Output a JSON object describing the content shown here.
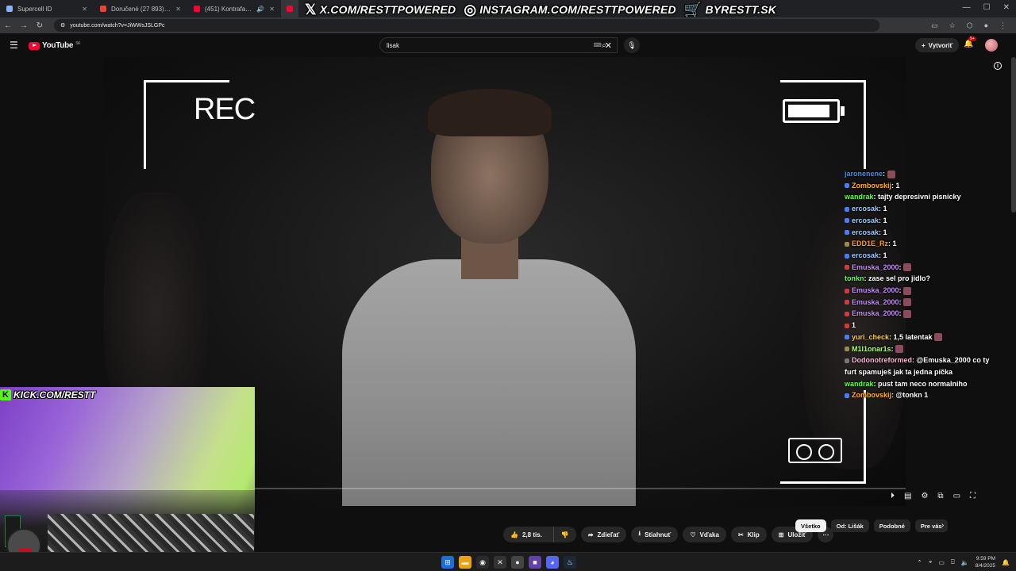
{
  "browser": {
    "tabs": [
      {
        "title": "Supercell ID",
        "icon": "supercell-icon"
      },
      {
        "title": "Doručené (27 893) - resttpowe",
        "icon": "gmail-icon"
      },
      {
        "title": "(451) Kontrafakt - #SSMD (",
        "icon": "youtube-icon"
      },
      {
        "title": "(4",
        "icon": "youtube-icon"
      }
    ],
    "url": "youtube.com/watch?v=JiWWsJSLGPc"
  },
  "overlay": {
    "socials": [
      {
        "icon": "x-logo-icon",
        "label": "X.COM/RESTTPOWERED"
      },
      {
        "icon": "instagram-icon",
        "label": "INSTAGRAM.COM/RESTTPOWERED"
      },
      {
        "icon": "cart-icon",
        "label": "BYRESTT.SK"
      }
    ],
    "kick_label": "KICK.COM/RESTT"
  },
  "youtube": {
    "logo_text": "YouTube",
    "logo_region": "SK",
    "search_value": "lisak",
    "create_label": "Vytvoriť",
    "notifications_badge": "9+",
    "rec_label": "REC",
    "actions": {
      "likes": "2,8 tis.",
      "share": "Zdieľať",
      "download": "Stiahnuť",
      "thanks": "Vďaka",
      "clip": "Klip",
      "save": "Uložiť"
    },
    "chips": [
      "Všetko",
      "Od: Lišák",
      "Podobné",
      "Pre vás"
    ]
  },
  "chat": [
    {
      "user": "jaronenene",
      "color": "#3c8cff",
      "text": "",
      "emote": true
    },
    {
      "user": "Zombovskij",
      "color": "#ffb31a",
      "text": "1",
      "badge": "#4a7cff"
    },
    {
      "user": "wandrak",
      "color": "#62ff4a",
      "text": "tajty depresivni pisnicky"
    },
    {
      "user": "ercosak",
      "color": "#9acbff",
      "text": "1",
      "badge": "#4a7cff"
    },
    {
      "user": "ercosak",
      "color": "#9acbff",
      "text": "1",
      "badge": "#4a7cff"
    },
    {
      "user": "ercosak",
      "color": "#9acbff",
      "text": "1",
      "badge": "#4a7cff"
    },
    {
      "user": "EDD1E_Rz",
      "color": "#ff9a2e",
      "text": "1",
      "badge": "#9b8a4a"
    },
    {
      "user": "ercosak",
      "color": "#9acbff",
      "text": "1",
      "badge": "#4a7cff"
    },
    {
      "user": "Emuska_2000",
      "color": "#c58bff",
      "text": "",
      "badge": "#d13b3b",
      "emote": true
    },
    {
      "user": "tonkn",
      "color": "#62ff4a",
      "text": "zase sel pro jidlo?"
    },
    {
      "user": "Emuska_2000",
      "color": "#c58bff",
      "text": "",
      "badge": "#d13b3b",
      "emote": true
    },
    {
      "user": "Emuska_2000",
      "color": "#c58bff",
      "text": "",
      "badge": "#d13b3b",
      "emote": true
    },
    {
      "user": "Emuska_2000",
      "color": "#c58bff",
      "text": "",
      "badge": "#d13b3b",
      "emote": true
    },
    {
      "user": "",
      "color": "#ff2d55",
      "text": "1",
      "badge": "#d13b3b"
    },
    {
      "user": "yuri_check",
      "color": "#ffd21a",
      "text": "1,5 latentak",
      "badge": "#4a7cff",
      "emote": true
    },
    {
      "user": "M1l1onar1s",
      "color": "#a6ff6a",
      "text": "",
      "badge": "#9b8a4a",
      "emote": true
    },
    {
      "user": "Dodonotreformed",
      "color": "#ffb6d9",
      "text": "@Emuska_2000 co ty",
      "badge": "#777"
    },
    {
      "user": "",
      "color": "#ffffff",
      "text": "furt spamuješ jak ta jedna píčka"
    },
    {
      "user": "wandrak",
      "color": "#62ff4a",
      "text": "pust tam neco normalniho"
    },
    {
      "user": "Zombovskij",
      "color": "#ffb31a",
      "text": "@tonkn 1",
      "badge": "#4a7cff"
    }
  ],
  "taskbar": {
    "time": "9:59 PM",
    "date": "8/4/2025"
  }
}
